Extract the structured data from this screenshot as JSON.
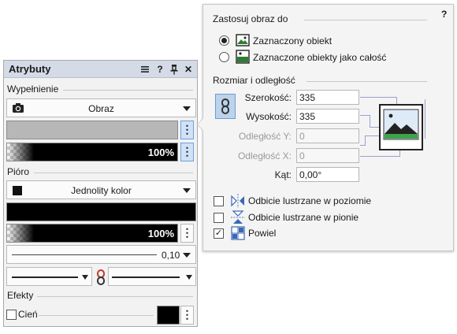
{
  "attributes": {
    "title": "Atrybuty",
    "toolbar": {
      "menu_icon": "menu-icon",
      "help_label": "?",
      "pin_icon": "pin-icon",
      "close_label": "✕"
    },
    "fill": {
      "section_label": "Wypełnienie",
      "type_label": "Obraz",
      "type_icon": "camera-icon",
      "swatch_color": "#b7b7b7",
      "opacity": "100%"
    },
    "pen": {
      "section_label": "Pióro",
      "type_label": "Jednolity kolor",
      "color": "#000000",
      "opacity": "100%",
      "line_width": "0,10"
    },
    "effects": {
      "section_label": "Efekty",
      "shadow_label": "Cień",
      "shadow_checked": false,
      "shadow_color": "#000000"
    },
    "kebab_label": "⋮"
  },
  "apply_image": {
    "section_label": "Zastosuj obraz do",
    "help_label": "?",
    "options": [
      {
        "label": "Zaznaczony obiekt",
        "selected": true
      },
      {
        "label": "Zaznaczone obiekty jako całość",
        "selected": false
      }
    ]
  },
  "size_offset": {
    "section_label": "Rozmiar i odległość",
    "width_label": "Szerokość:",
    "width_value": "335",
    "height_label": "Wysokość:",
    "height_value": "335",
    "offset_y_label": "Odległość Y:",
    "offset_y_value": "0",
    "offset_x_label": "Odległość X:",
    "offset_x_value": "0",
    "angle_label": "Kąt:",
    "angle_value": "0,00°"
  },
  "transform": {
    "mirror_h_label": "Odbicie lustrzane w poziomie",
    "mirror_h_checked": false,
    "mirror_v_label": "Odbicie lustrzane w pionie",
    "mirror_v_checked": false,
    "tile_label": "Powiel",
    "tile_checked": true
  },
  "colors": {
    "accent": "#6ea1d6",
    "titlebar": "#d4dbe7",
    "connector": "#9aa0cc"
  }
}
